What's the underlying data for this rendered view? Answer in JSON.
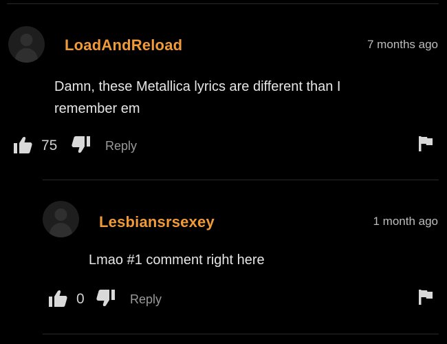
{
  "comments": [
    {
      "username": "LoadAndReload",
      "timestamp": "7 months ago",
      "text": "Damn, these Metallica lyrics are different than I remember em",
      "likes": "75",
      "reply_label": "Reply"
    },
    {
      "username": "Lesbiansrsexey",
      "timestamp": "1 month ago",
      "text": "Lmao #1 comment right here",
      "likes": "0",
      "reply_label": "Reply"
    }
  ],
  "icons": {
    "avatar": "user-avatar-placeholder",
    "like": "thumbs-up-icon",
    "dislike": "thumbs-down-icon",
    "report": "flag-icon"
  },
  "colors": {
    "background": "#000000",
    "username": "#f19a38",
    "text": "#e6e6e6",
    "muted": "#9a9a9a",
    "divider": "#2a2a2a"
  }
}
